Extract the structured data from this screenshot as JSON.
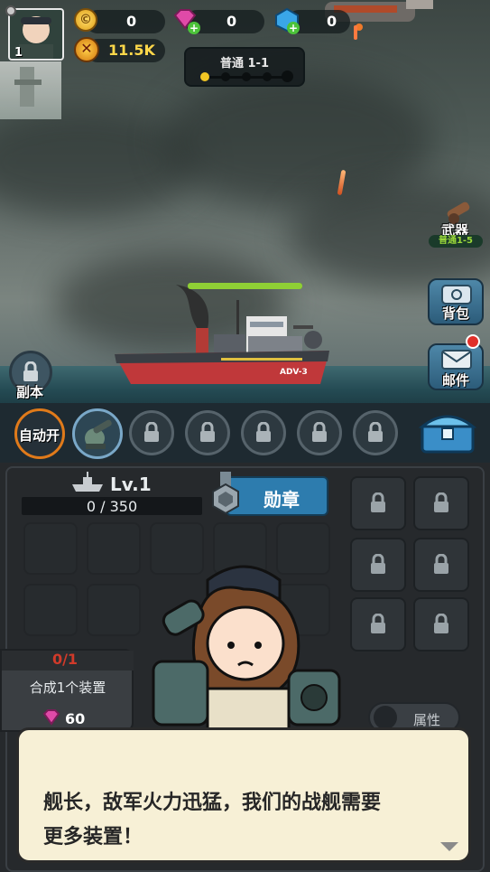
{
  "hud": {
    "player_level": "1",
    "coins": "0",
    "gems": "0",
    "crystals": "0",
    "power": "11.5K"
  },
  "stage": {
    "label": "普通 1-1",
    "progress_nodes": 5,
    "current_node": 1
  },
  "weapon_button": {
    "label": "武器",
    "sub": "普通1-5"
  },
  "side_buttons": {
    "bag": "背包",
    "mail": "邮件"
  },
  "dungeon_button": {
    "label": "副本"
  },
  "ship": {
    "hull_text": "ADV-3",
    "health_fraction": 1.0
  },
  "slot_strip": {
    "auto_label": "自动开",
    "locked_slots": 5
  },
  "panel": {
    "level": "Lv.1",
    "exp": "0 / 350",
    "medal_button": "勋章",
    "task_progress": "0/1",
    "task_text": "合成1个装置",
    "task_reward": "60",
    "attr_button": "属性"
  },
  "dialog": {
    "text_line1": "舰长，敌军火力迅猛，我们的战舰需要",
    "text_line2": "更多装置！"
  },
  "colors": {
    "accent_green": "#9ad83a",
    "medal_blue": "#2d7cae",
    "dialog_bg": "#f7f0d6",
    "task_red": "#d03a2a"
  }
}
